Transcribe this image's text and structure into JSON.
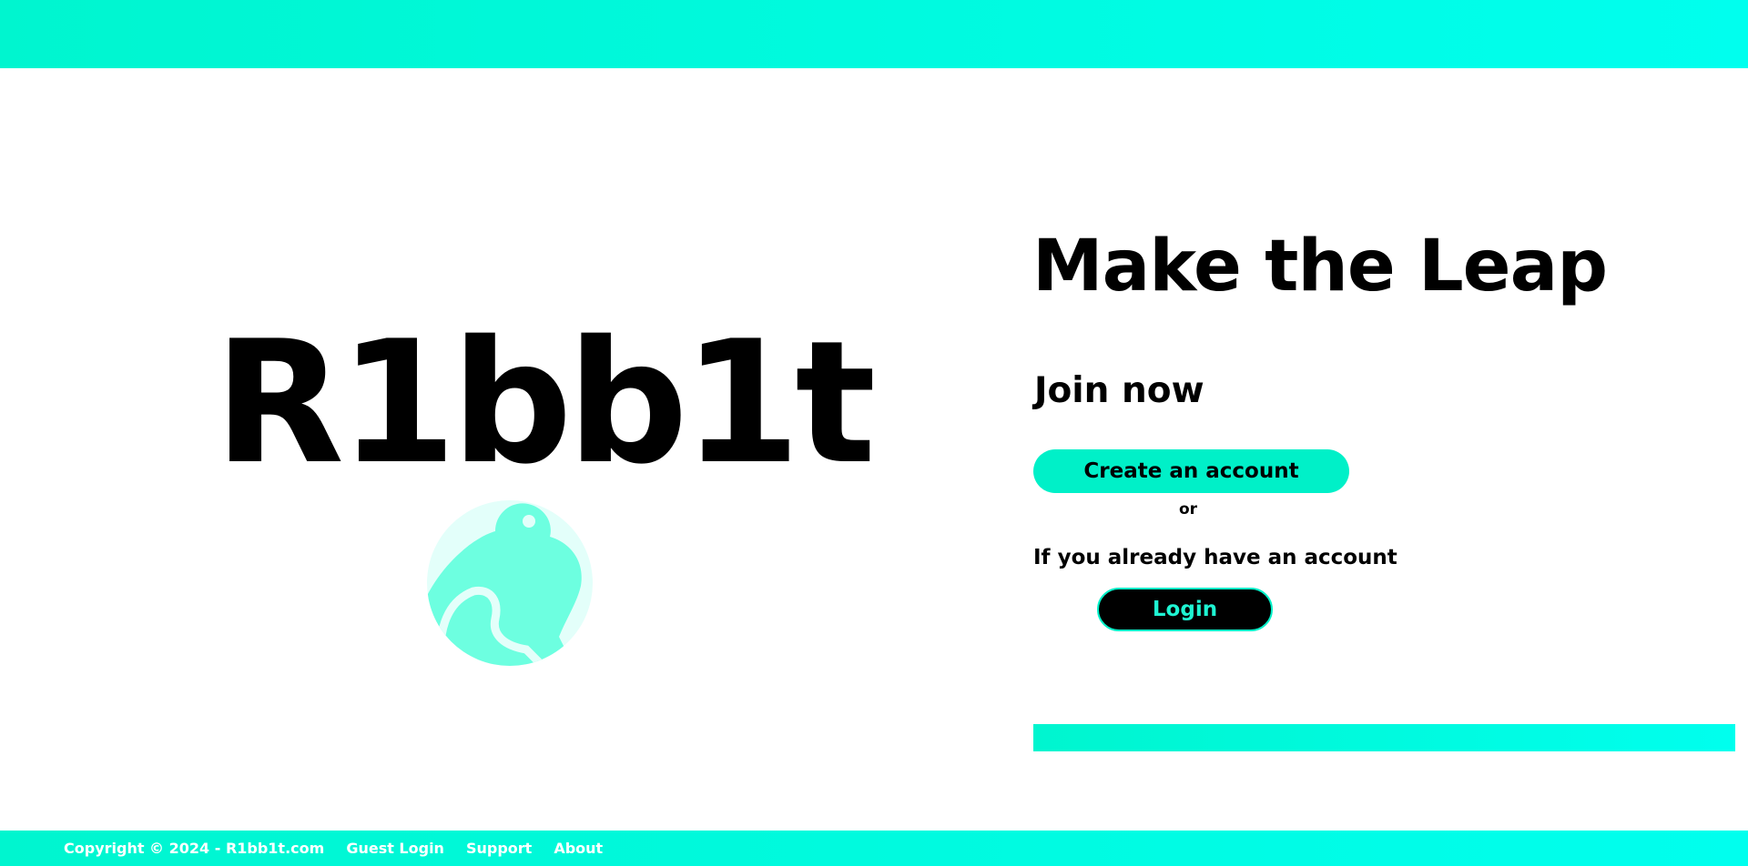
{
  "header": {
    "bar_color": "#00f5cf"
  },
  "brand": {
    "name": "R1bb1t",
    "logo_icon": "frog-icon"
  },
  "main": {
    "headline": "Make the Leap",
    "subheading": "Join now",
    "create_account_label": "Create an account",
    "or_label": "or",
    "existing_account_text": "If you already have an account",
    "login_label": "Login"
  },
  "footer": {
    "copyright": "Copyright © 2024 - R1bb1t.com",
    "links": [
      "Guest Login",
      "Support",
      "About"
    ]
  },
  "colors": {
    "accent": "#00f0c8",
    "accent_light": "#00ffee",
    "logo_fill": "#6dffe0",
    "logo_bg": "#e3fffa",
    "text": "#000000"
  }
}
